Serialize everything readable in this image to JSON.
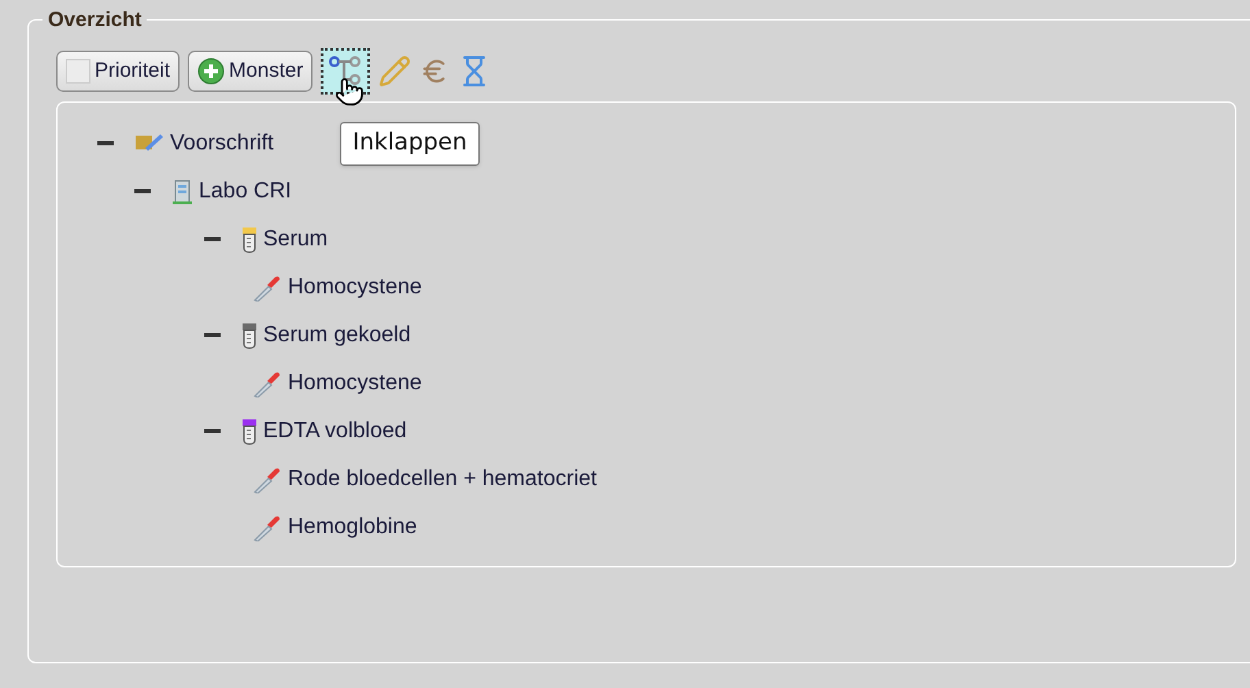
{
  "panel": {
    "legend": "Overzicht"
  },
  "toolbar": {
    "priority": {
      "label": "Prioriteit",
      "checked": false
    },
    "sample_button": {
      "label": "Monster"
    },
    "tree_toggle": {
      "focused": true
    },
    "tooltip": "Inklappen"
  },
  "tree": [
    {
      "kind": "prescription",
      "label": "Voorschrift",
      "expanded": true,
      "children": [
        {
          "kind": "lab",
          "label": "Labo CRI",
          "expanded": true,
          "children": [
            {
              "kind": "tube",
              "label": "Serum",
              "color": "#f2c84b",
              "expanded": true,
              "children": [
                {
                  "kind": "test",
                  "label": "Homocystene"
                }
              ]
            },
            {
              "kind": "tube",
              "label": "Serum gekoeld",
              "color": "#6b6b6b",
              "expanded": true,
              "children": [
                {
                  "kind": "test",
                  "label": "Homocystene"
                }
              ]
            },
            {
              "kind": "tube",
              "label": "EDTA volbloed",
              "color": "#9b30f0",
              "expanded": true,
              "children": [
                {
                  "kind": "test",
                  "label": "Rode bloedcellen + hematocriet"
                },
                {
                  "kind": "test",
                  "label": "Hemoglobine"
                }
              ]
            }
          ]
        }
      ]
    }
  ]
}
